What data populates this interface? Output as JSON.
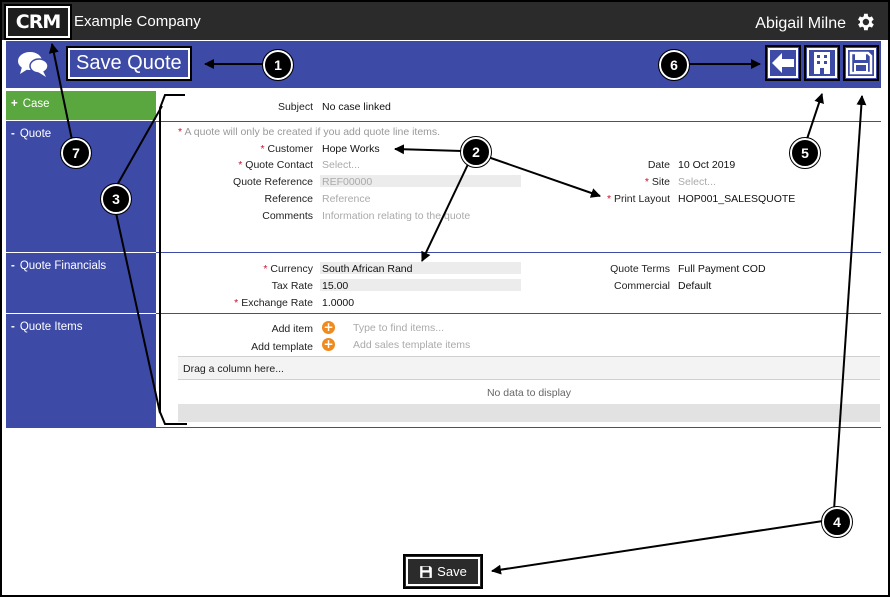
{
  "app": {
    "logo_text": "CRM",
    "company": "Example Company",
    "user": "Abigail Milne"
  },
  "header": {
    "title": "Save Quote"
  },
  "sections": {
    "case": {
      "sign": "+",
      "label": "Case"
    },
    "quote": {
      "sign": "-",
      "label": "Quote"
    },
    "financials": {
      "sign": "-",
      "label": "Quote Financials"
    },
    "items": {
      "sign": "-",
      "label": "Quote Items"
    }
  },
  "case_section": {
    "subject_label": "Subject",
    "subject_value": "No case linked"
  },
  "quote_section": {
    "notice": "A quote will only be created if you add quote line items.",
    "customer_label": "Customer",
    "customer_value": "Hope Works",
    "contact_label": "Quote Contact",
    "contact_placeholder": "Select...",
    "reference_quote_label": "Quote Reference",
    "reference_quote_value": "REF00000",
    "reference_label": "Reference",
    "reference_placeholder": "Reference",
    "comments_label": "Comments",
    "comments_placeholder": "Information relating to the quote",
    "date_label": "Date",
    "date_value": "10 Oct 2019",
    "site_label": "Site",
    "site_placeholder": "Select...",
    "print_layout_label": "Print Layout",
    "print_layout_value": "HOP001_SALESQUOTE"
  },
  "financials_section": {
    "currency_label": "Currency",
    "currency_value": "South African Rand",
    "tax_rate_label": "Tax Rate",
    "tax_rate_value": "15.00",
    "exchange_rate_label": "Exchange Rate",
    "exchange_rate_value": "1.0000",
    "quote_terms_label": "Quote Terms",
    "quote_terms_value": "Full Payment COD",
    "commercial_label": "Commercial",
    "commercial_value": "Default"
  },
  "items_section": {
    "add_item_label": "Add item",
    "add_item_placeholder": "Type to find items...",
    "add_template_label": "Add template",
    "add_template_placeholder": "Add sales template items",
    "grid_group_hint": "Drag a column here...",
    "grid_empty": "No data to display"
  },
  "footer": {
    "save_label": "Save"
  },
  "callouts": [
    "1",
    "2",
    "3",
    "4",
    "5",
    "6",
    "7"
  ],
  "icons": {
    "gear": "gear-icon",
    "chat": "chat-bubbles-icon",
    "back": "arrow-left-icon",
    "building": "building-icon",
    "save": "floppy-disk-icon"
  },
  "colors": {
    "topbar": "#2b2b2b",
    "primary": "#3d4aa6",
    "case_green": "#5aa73f",
    "required": "#c8102e",
    "add_orange": "#f08a1c"
  }
}
